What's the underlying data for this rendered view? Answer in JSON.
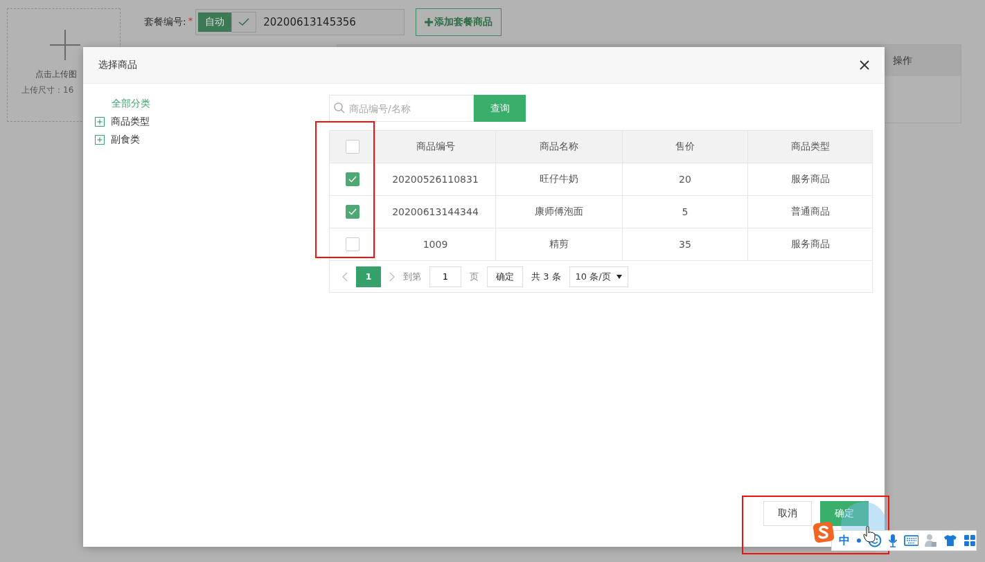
{
  "background_page": {
    "upload": {
      "hint": "点击上传图",
      "size_hint": "上传尺寸：16"
    },
    "form": {
      "label": "套餐编号:",
      "required_mark": "*",
      "auto": {
        "label": "自动",
        "checked": true
      },
      "value": "20200613145356",
      "add_button": "添加套餐商品"
    },
    "table_header": [
      "操作"
    ]
  },
  "dialog": {
    "title": "选择商品",
    "tree": {
      "root": {
        "label": "全部分类",
        "selected": true
      },
      "items": [
        {
          "label": "商品类型",
          "expanded": false
        },
        {
          "label": "副食类",
          "expanded": false
        }
      ]
    },
    "search": {
      "placeholder": "商品编号/名称",
      "button": "查询"
    },
    "table": {
      "select_all": {
        "checked": false
      },
      "columns": [
        "商品编号",
        "商品名称",
        "售价",
        "商品类型"
      ],
      "rows": [
        {
          "checked": true,
          "cells": [
            "20200526110831",
            "旺仔牛奶",
            "20",
            "服务商品"
          ]
        },
        {
          "checked": true,
          "cells": [
            "20200613144344",
            "康师傅泡面",
            "5",
            "普通商品"
          ]
        },
        {
          "checked": false,
          "cells": [
            "1009",
            "精剪",
            "35",
            "服务商品"
          ]
        }
      ]
    },
    "pagination": {
      "pages": [
        {
          "label": "1",
          "selected": true
        }
      ],
      "goto_label": "到第",
      "goto_value": "1",
      "page_unit": "页",
      "confirm": "确定",
      "total": "共 3 条",
      "page_size": "10 条/页"
    },
    "buttons": [
      {
        "kind": "secondary",
        "label": "取消"
      },
      {
        "kind": "primary",
        "label": "确定"
      }
    ]
  },
  "ime_toolbar": {
    "mode": "中"
  }
}
